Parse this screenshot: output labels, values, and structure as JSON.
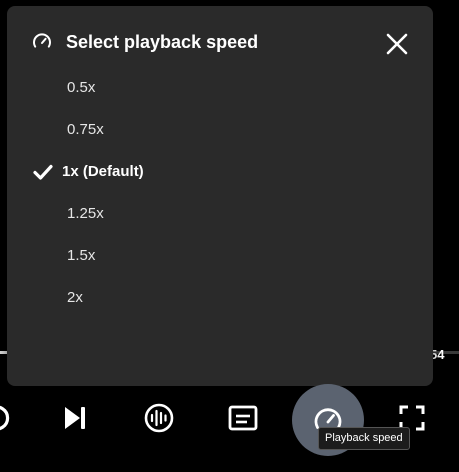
{
  "panel": {
    "title": "Select playback speed",
    "header_icon": "speedometer-icon",
    "close_icon": "close-icon",
    "options": [
      {
        "label": "0.5x",
        "selected": false
      },
      {
        "label": "0.75x",
        "selected": false
      },
      {
        "label": "1x (Default)",
        "selected": true
      },
      {
        "label": "1.25x",
        "selected": false
      },
      {
        "label": "1.5x",
        "selected": false
      },
      {
        "label": "2x",
        "selected": false
      }
    ],
    "selected_icon": "checkmark-icon"
  },
  "player": {
    "time_fragment": "54",
    "controls": [
      {
        "name": "partial-control-icon"
      },
      {
        "name": "skip-next-icon"
      },
      {
        "name": "audio-description-icon"
      },
      {
        "name": "captions-icon"
      },
      {
        "name": "playback-speed-icon",
        "active": true
      },
      {
        "name": "fullscreen-icon"
      }
    ],
    "tooltip": "Playback speed"
  },
  "colors": {
    "background": "#000000",
    "panel": "#2a2a2a",
    "text": "#ffffff",
    "active_control": "#5b6370"
  }
}
